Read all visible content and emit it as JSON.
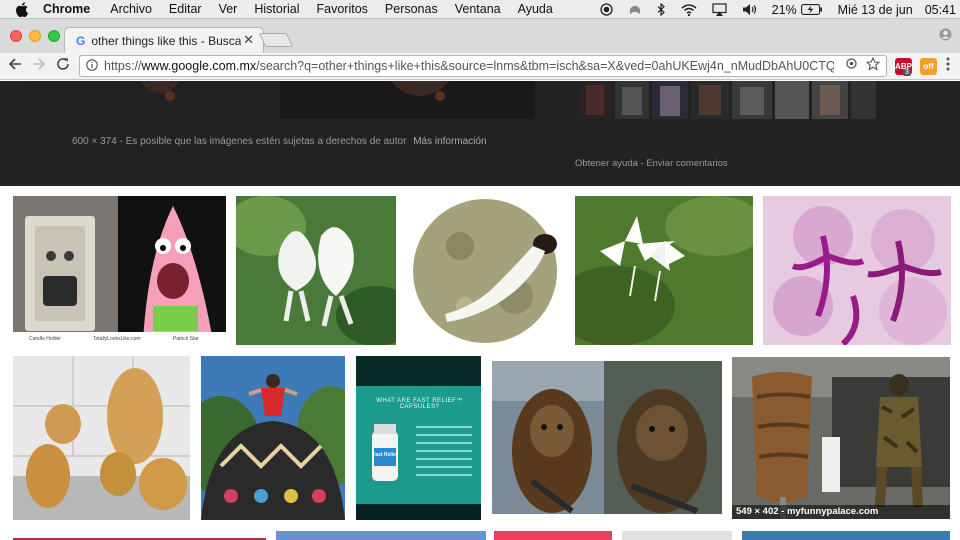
{
  "menubar": {
    "app": "Chrome",
    "items": [
      "Archivo",
      "Editar",
      "Ver",
      "Historial",
      "Favoritos",
      "Personas",
      "Ventana",
      "Ayuda"
    ],
    "battery": "21%",
    "date": "Mié 13 de jun",
    "time": "05:41"
  },
  "browser": {
    "tab_title": "other things like this - Buscar con Google",
    "tab_close": "✕",
    "url_prefix": "https://",
    "url_host": "www.google.com.mx",
    "url_path": "/search?q=other+things+like+this&source=lnms&tbm=isch&sa=X&ved=0ahUKEwj4n_nMudDbAhU0CTQI...",
    "ext1_label": "ABP",
    "ext1_badge": "3",
    "ext2_label": "off"
  },
  "preview": {
    "dimensions": "600 × 374",
    "separator": "-",
    "copyright": "Es posible que las imágenes estén sujetas a derechos de autor",
    "more_info": "Más información",
    "help": "Obtener ayuda",
    "help_sep": "-",
    "feedback": "Enviar comentarios"
  },
  "results": {
    "captions": {
      "candle_holder": "Candle Holder",
      "site": "TotallyLooksLike.com",
      "patrick": "Patrick Star"
    },
    "tile9_heading": "WHAT ARE FAST RELIEF™ CAPSULES?",
    "tile9_bottle": "Fast Relief",
    "tile12_overlay": "549 × 402 - myfunnypalace.com"
  },
  "colors": {
    "menubar_bg": "#ececec",
    "tabstrip_bg": "#dadada",
    "dark_panel": "#222222",
    "close_red": "#fc615d",
    "min_yellow": "#fdbc40",
    "max_green": "#34c84a"
  }
}
